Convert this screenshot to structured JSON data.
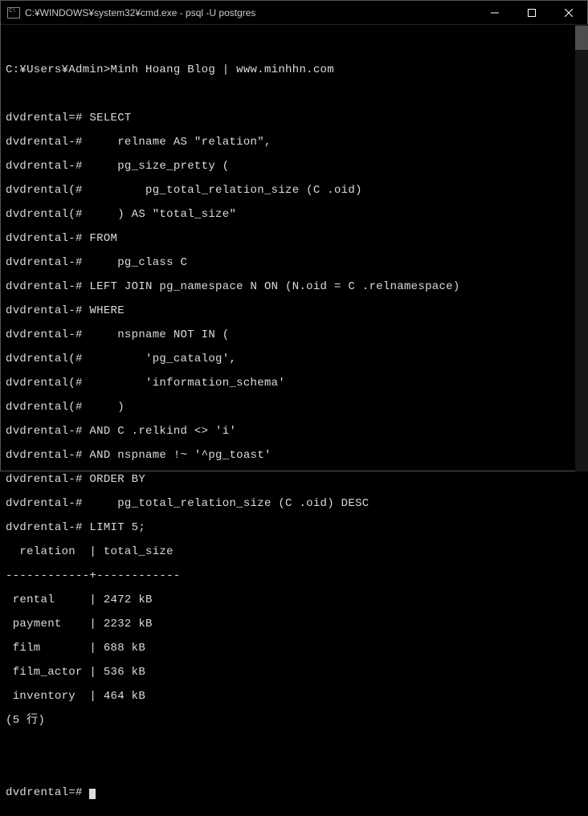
{
  "window": {
    "title": "C:¥WINDOWS¥system32¥cmd.exe - psql  -U postgres"
  },
  "header_line": "C:¥Users¥Admin>Minh Hoang Blog | www.minhhn.com",
  "sql_lines": [
    "dvdrental=# SELECT",
    "dvdrental-#     relname AS \"relation\",",
    "dvdrental-#     pg_size_pretty (",
    "dvdrental(#         pg_total_relation_size (C .oid)",
    "dvdrental(#     ) AS \"total_size\"",
    "dvdrental-# FROM",
    "dvdrental-#     pg_class C",
    "dvdrental-# LEFT JOIN pg_namespace N ON (N.oid = C .relnamespace)",
    "dvdrental-# WHERE",
    "dvdrental-#     nspname NOT IN (",
    "dvdrental(#         'pg_catalog',",
    "dvdrental(#         'information_schema'",
    "dvdrental(#     )",
    "dvdrental-# AND C .relkind <> 'i'",
    "dvdrental-# AND nspname !~ '^pg_toast'",
    "dvdrental-# ORDER BY",
    "dvdrental-#     pg_total_relation_size (C .oid) DESC",
    "dvdrental-# LIMIT 5;"
  ],
  "result_header": "  relation  | total_size",
  "result_sep": "------------+------------",
  "chart_data": {
    "type": "table",
    "columns": [
      "relation",
      "total_size"
    ],
    "rows": [
      {
        "relation": "rental",
        "total_size": "2472 kB"
      },
      {
        "relation": "payment",
        "total_size": "2232 kB"
      },
      {
        "relation": "film",
        "total_size": "688 kB"
      },
      {
        "relation": "film_actor",
        "total_size": "536 kB"
      },
      {
        "relation": "inventory",
        "total_size": "464 kB"
      }
    ]
  },
  "result_lines": [
    " rental     | 2472 kB",
    " payment    | 2232 kB",
    " film       | 688 kB",
    " film_actor | 536 kB",
    " inventory  | 464 kB"
  ],
  "row_count": "(5 行)",
  "prompt": "dvdrental=# "
}
